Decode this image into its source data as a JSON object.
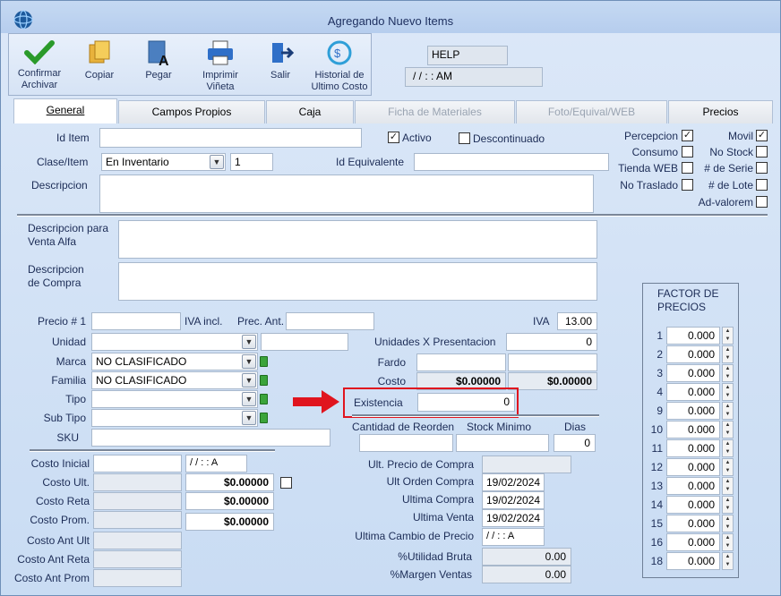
{
  "window": {
    "title": "Agregando Nuevo Items"
  },
  "toolbar": {
    "confirm": "Confirmar\nArchivar",
    "copy": "Copiar",
    "paste": "Pegar",
    "print": "Imprimir\nViñeta",
    "exit": "Salir",
    "history": "Historial de\nUltimo Costo"
  },
  "help": {
    "label": "HELP",
    "datetime": "/ /       :  :   AM"
  },
  "tabs": [
    "General",
    "Campos Propios",
    "Caja",
    "Ficha de Materiales",
    "Foto/Equival/WEB",
    "Precios"
  ],
  "top": {
    "id_item_label": "Id Item",
    "id_item": "",
    "activo": "Activo",
    "descontinuado": "Descontinuado",
    "clase_label": "Clase/Item",
    "clase": "En Inventario",
    "clase_num": "1",
    "id_equiv_label": "Id Equivalente",
    "id_equiv": "",
    "descripcion_label": "Descripcion",
    "descripcion": ""
  },
  "flags": {
    "percepcion": "Percepcion",
    "consumo": "Consumo",
    "tienda_web": "Tienda WEB",
    "no_traslado": "No Traslado",
    "movil": "Movil",
    "no_stock": "No Stock",
    "de_serie": "# de Serie",
    "de_lote": "# de Lote",
    "ad_valorem": "Ad-valorem"
  },
  "desc": {
    "venta_alfa": "Descripcion para\nVenta Alfa",
    "compra": "Descripcion\nde Compra"
  },
  "prices": {
    "precio1": "Precio # 1",
    "iva_incl": "IVA incl.",
    "prec_ant": "Prec. Ant.",
    "iva": "IVA",
    "iva_val": "13.00",
    "unidad": "Unidad",
    "unidades_x": "Unidades X Presentacion",
    "unidades_x_val": "0",
    "marca": "Marca",
    "marca_val": "NO CLASIFICADO",
    "fardo": "Fardo",
    "familia": "Familia",
    "familia_val": "NO CLASIFICADO",
    "costo": "Costo",
    "costo_val1": "$0.00000",
    "costo_val2": "$0.00000",
    "tipo": "Tipo",
    "existencia": "Existencia",
    "existencia_val": "0",
    "sub_tipo": "Sub Tipo",
    "sku": "SKU",
    "cant_reorden": "Cantidad de Reorden",
    "stock_min": "Stock Minimo",
    "dias": "Dias",
    "dias_val": "0"
  },
  "costs": {
    "costo_inicial": "Costo Inicial",
    "costo_inicial_date": "/ /       :  :  A",
    "costo_ult": "Costo Ult.",
    "costo_ult_val": "$0.00000",
    "costo_reta": "Costo Reta",
    "costo_reta_val": "$0.00000",
    "costo_prom": "Costo Prom.",
    "costo_prom_val": "$0.00000",
    "costo_ant_ult": "Costo Ant Ult",
    "costo_ant_reta": "Costo Ant Reta",
    "costo_ant_prom": "Costo Ant Prom"
  },
  "history": {
    "ult_precio_compra": "Ult. Precio de Compra",
    "ult_orden_compra": "Ult Orden Compra",
    "ult_orden_compra_val": "19/02/2024",
    "ultima_compra": "Ultima Compra",
    "ultima_compra_val": "19/02/2024",
    "ultima_venta": "Ultima Venta",
    "ultima_venta_val": "19/02/2024",
    "ultima_cambio": "Ultima Cambio de Precio",
    "ultima_cambio_val": "/ /       :  :  A",
    "utilidad": "%Utilidad Bruta",
    "utilidad_val": "0.00",
    "margen": "%Margen Ventas",
    "margen_val": "0.00"
  },
  "factor": {
    "title": "FACTOR DE\nPRECIOS",
    "rows": [
      {
        "n": "1",
        "v": "0.000"
      },
      {
        "n": "2",
        "v": "0.000"
      },
      {
        "n": "3",
        "v": "0.000"
      },
      {
        "n": "4",
        "v": "0.000"
      },
      {
        "n": "9",
        "v": "0.000"
      },
      {
        "n": "10",
        "v": "0.000"
      },
      {
        "n": "11",
        "v": "0.000"
      },
      {
        "n": "12",
        "v": "0.000"
      },
      {
        "n": "13",
        "v": "0.000"
      },
      {
        "n": "14",
        "v": "0.000"
      },
      {
        "n": "15",
        "v": "0.000"
      },
      {
        "n": "16",
        "v": "0.000"
      },
      {
        "n": "18",
        "v": "0.000"
      }
    ]
  },
  "colors": {
    "highlight": "#e0141e",
    "accent": "#2b6fc4"
  }
}
